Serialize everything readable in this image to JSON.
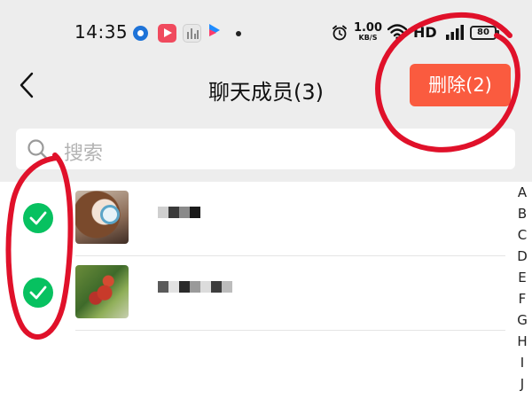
{
  "status_bar": {
    "time": "14:35",
    "net_speed_value": "1.00",
    "net_speed_unit": "KB/S",
    "network_label": "HD",
    "battery_level": "80",
    "notification_icons": [
      "circle-app-icon",
      "video-play-app-icon",
      "music-app-icon",
      "video-app-icon"
    ]
  },
  "nav": {
    "title": "聊天成员(3)",
    "delete_label": "删除(2)"
  },
  "search": {
    "placeholder": "搜索"
  },
  "members": [
    {
      "selected": true,
      "avatar": "avatar-anime-girl",
      "name": ""
    },
    {
      "selected": true,
      "avatar": "avatar-fruit-tree",
      "name": ""
    }
  ],
  "index_letters": [
    "A",
    "B",
    "C",
    "D",
    "E",
    "F",
    "G",
    "H",
    "I",
    "J"
  ],
  "colors": {
    "accent_delete": "#fa5b3f",
    "check_green": "#07c160",
    "annotation_red": "#e0112a",
    "header_background": "#ededed"
  }
}
